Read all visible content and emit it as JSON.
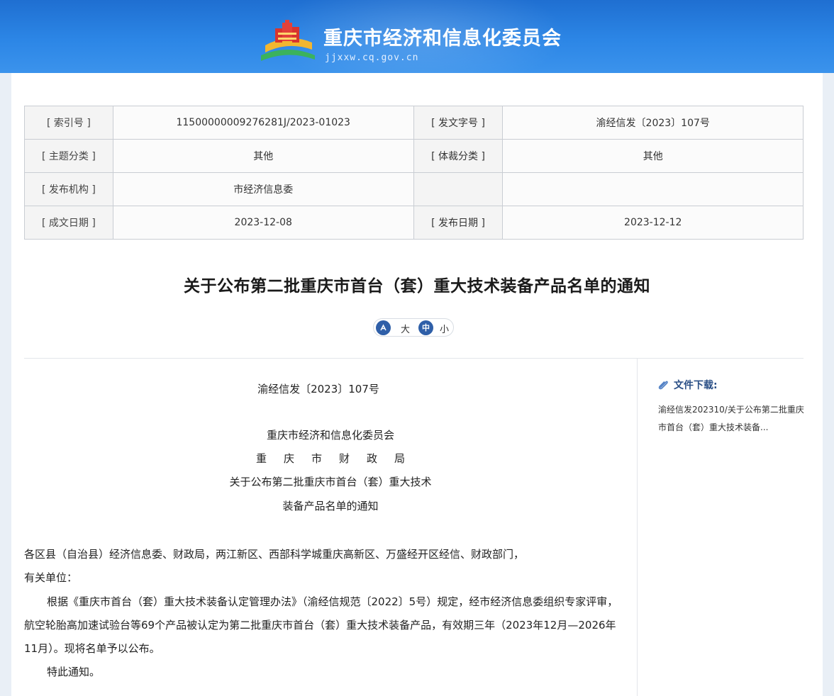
{
  "header": {
    "site_title": "重庆市经济和信息化委员会",
    "site_domain": "jjxxw.cq.gov.cn",
    "background_color": "#2a7fde"
  },
  "meta": {
    "rows": [
      {
        "label1": "[ 索引号 ]",
        "value1": "11500000009276281J/2023-01023",
        "label2": "[ 发文字号 ]",
        "value2": "渝经信发〔2023〕107号"
      },
      {
        "label1": "[ 主题分类 ]",
        "value1": "其他",
        "label2": "[ 体裁分类 ]",
        "value2": "其他"
      },
      {
        "label1": "[ 发布机构 ]",
        "value1": "市经济信息委",
        "label2": "",
        "value2": ""
      },
      {
        "label1": "[ 成文日期 ]",
        "value1": "2023-12-08",
        "label2": "[ 发布日期 ]",
        "value2": "2023-12-12"
      }
    ]
  },
  "article": {
    "title": "关于公布第二批重庆市首台（套）重大技术装备产品名单的通知",
    "font_control": {
      "large_label": "大",
      "medium_glyph": "中",
      "small_label": "小"
    },
    "doc_number": "渝经信发〔2023〕107号",
    "issuers": [
      "重庆市经济和信息化委员会",
      "重庆市财政局"
    ],
    "inner_title_lines": [
      "关于公布第二批重庆市首台（套）重大技术",
      "装备产品名单的通知"
    ],
    "recipients_line1": "各区县（自治县）经济信息委、财政局，两江新区、西部科学城重庆高新区、万盛经开区经信、财政部门，",
    "recipients_line2": "有关单位：",
    "body_paragraph": "根据《重庆市首台（套）重大技术装备认定管理办法》（渝经信规范〔2022〕5号）规定，经市经济信息委组织专家评审，航空轮胎高加速试验台等69个产品被认定为第二批重庆市首台（套）重大技术装备产品，有效期三年（2023年12月—2026年11月）。现将名单予以公布。",
    "closing": "特此通知。"
  },
  "sidebar": {
    "download_heading": "文件下载:",
    "download_link": "渝经信发202310/关于公布第二批重庆市首台（套）重大技术装备..."
  }
}
